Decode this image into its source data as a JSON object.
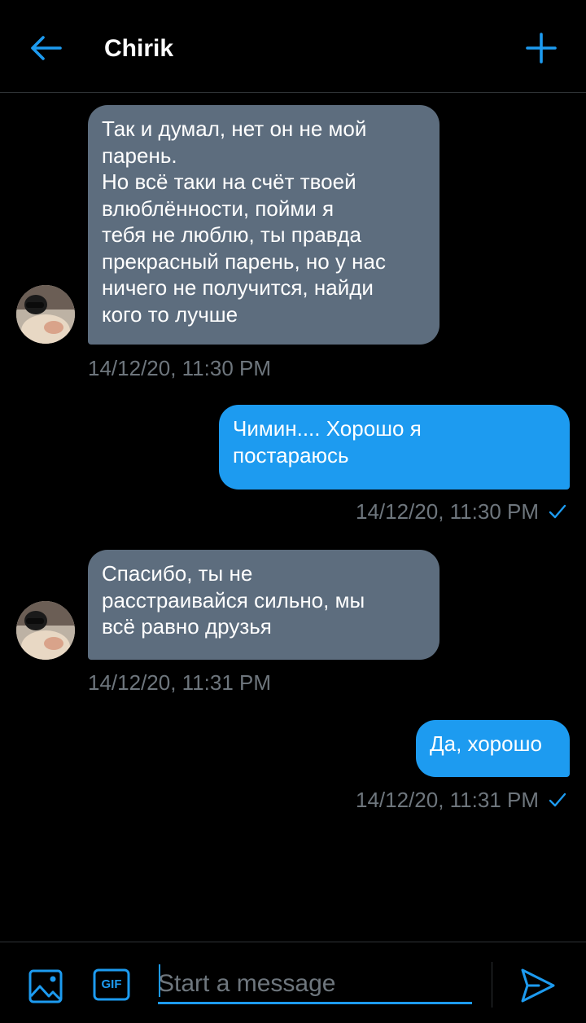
{
  "header": {
    "title": "Chirik",
    "back_icon": "arrow-left-icon",
    "add_icon": "plus-icon"
  },
  "messages": [
    {
      "direction": "incoming",
      "text": "Так и думал, нет он не мой\nпарень.\nНо всё таки на счёт твоей\nвлюблённости, пойми я\nтебя не люблю, ты правда\nпрекрасный парень, но у нас\nничего не получится, найди\nкого то лучше",
      "timestamp": "14/12/20, 11:30 PM"
    },
    {
      "direction": "outgoing",
      "text": "Чимин.... Хорошо я\nпостараюсь",
      "timestamp": "14/12/20, 11:30 PM"
    },
    {
      "direction": "incoming",
      "text": "Спасибо, ты не\nрасстраивайся сильно, мы\nвсё равно друзья",
      "timestamp": "14/12/20, 11:31 PM"
    },
    {
      "direction": "outgoing",
      "text": "Да, хорошо",
      "timestamp": "14/12/20, 11:31 PM"
    }
  ],
  "composer": {
    "placeholder": "Start a message",
    "value": "",
    "image_icon": "image-icon",
    "gif_label": "GIF",
    "send_icon": "send-icon"
  },
  "colors": {
    "background": "#000000",
    "accent": "#1d9bf0",
    "incoming_bubble": "#5d6d7e",
    "timestamp": "#6e767d",
    "divider": "#2f3336"
  }
}
